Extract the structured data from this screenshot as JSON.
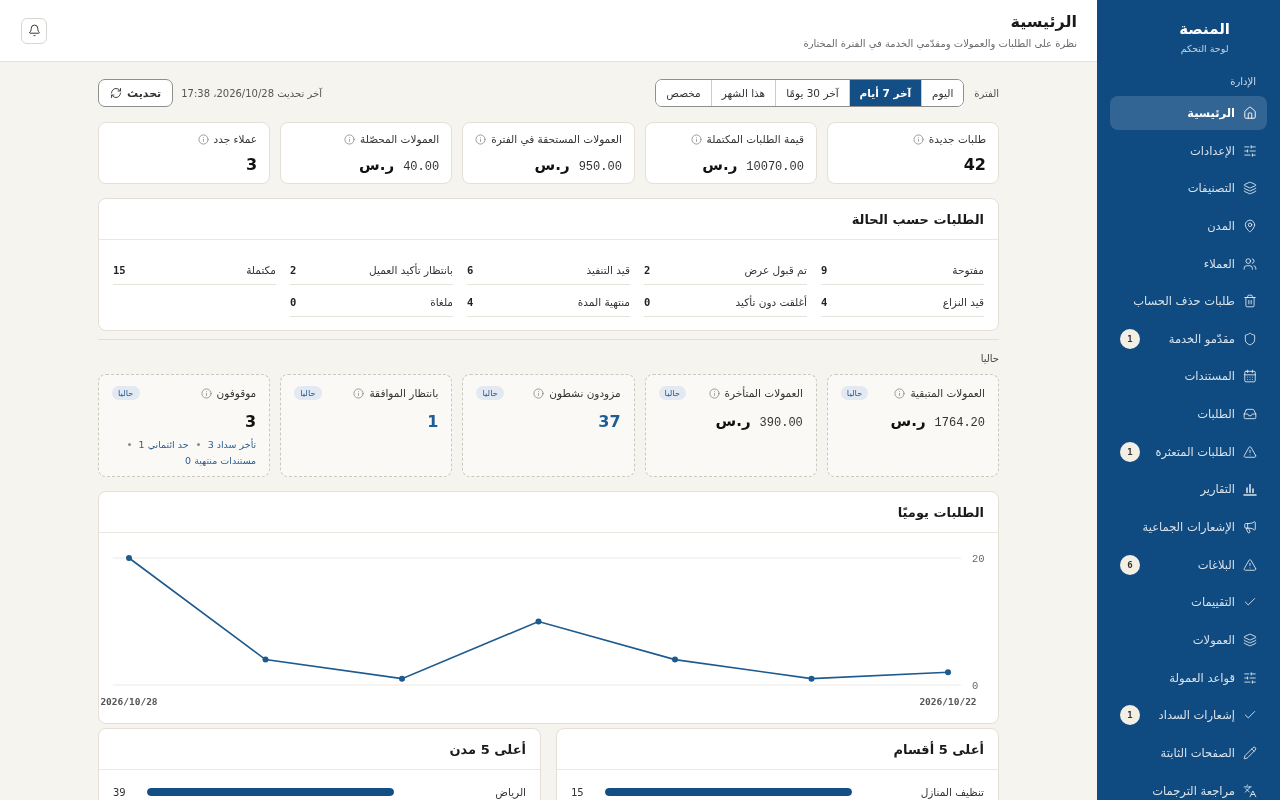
{
  "sidebar": {
    "brand": {
      "title": "المنصة",
      "subtitle": "لوحة التحكم"
    },
    "section_label": "الإدارة",
    "items": [
      {
        "label": "الرئيسية",
        "selected": true
      },
      {
        "label": "الإعدادات",
        "selected": false
      },
      {
        "label": "التصنيفات",
        "selected": false
      },
      {
        "label": "المدن",
        "selected": false
      },
      {
        "label": "العملاء",
        "selected": false
      },
      {
        "label": "طلبات حذف الحساب",
        "selected": false
      },
      {
        "label": "مقدّمو الخدمة",
        "selected": false,
        "badge": "1"
      },
      {
        "label": "المستندات",
        "selected": false
      },
      {
        "label": "الطلبات",
        "selected": false
      },
      {
        "label": "الطلبات المتعثرة",
        "selected": false,
        "badge": "1"
      },
      {
        "label": "التقارير",
        "selected": false
      },
      {
        "label": "الإشعارات الجماعية",
        "selected": false
      },
      {
        "label": "البلاغات",
        "selected": false,
        "badge": "6"
      },
      {
        "label": "التقييمات",
        "selected": false
      },
      {
        "label": "العمولات",
        "selected": false
      },
      {
        "label": "قواعد العمولة",
        "selected": false
      },
      {
        "label": "إشعارات السداد",
        "selected": false,
        "badge": "1"
      },
      {
        "label": "الصفحات الثابتة",
        "selected": false
      },
      {
        "label": "مراجعة الترجمات",
        "selected": false
      }
    ]
  },
  "header": {
    "title": "الرئيسية",
    "subtitle": "نظرة على الطلبات والعمولات ومقدّمي الخدمة في الفترة المختارة"
  },
  "toolbar": {
    "period_label": "الفترة",
    "periods": [
      {
        "label": "اليوم",
        "selected": false
      },
      {
        "label": "آخر 7 أيام",
        "selected": true
      },
      {
        "label": "آخر 30 يومًا",
        "selected": false
      },
      {
        "label": "هذا الشهر",
        "selected": false
      },
      {
        "label": "مخصص",
        "selected": false
      }
    ],
    "last_updated": "آخر تحديث 2026/10/28، 17:38",
    "refresh_label": "تحديث"
  },
  "kpis": [
    {
      "kind": "count",
      "title": "طلبات جديدة",
      "value": "42"
    },
    {
      "kind": "money",
      "title": "قيمة الطلبات المكتملة",
      "value": "10070.00",
      "currency": "ر.س"
    },
    {
      "kind": "money",
      "title": "العمولات المستحقة في الفترة",
      "value": "950.00",
      "currency": "ر.س"
    },
    {
      "kind": "money",
      "title": "العمولات المحصّلة",
      "value": "40.00",
      "currency": "ر.س"
    },
    {
      "kind": "count",
      "title": "عملاء جدد",
      "value": "3"
    }
  ],
  "status_breakdown": {
    "title": "الطلبات حسب الحالة",
    "items": [
      {
        "label": "مفتوحة",
        "count": "9"
      },
      {
        "label": "تم قبول عرض",
        "count": "2"
      },
      {
        "label": "قيد التنفيذ",
        "count": "6"
      },
      {
        "label": "بانتظار تأكيد العميل",
        "count": "2"
      },
      {
        "label": "مكتملة",
        "count": "15"
      },
      {
        "label": "قيد النزاع",
        "count": "4"
      },
      {
        "label": "أغلقت دون تأكيد",
        "count": "0"
      },
      {
        "label": "منتهية المدة",
        "count": "4"
      },
      {
        "label": "ملغاة",
        "count": "0"
      }
    ]
  },
  "current": {
    "label": "حاليا",
    "cards": [
      {
        "kind": "money",
        "title": "العمولات المتبقية",
        "badge": "حاليا",
        "value": "1764.20",
        "currency": "ر.س"
      },
      {
        "kind": "money",
        "title": "العمولات المتأخرة",
        "badge": "حاليا",
        "value": "390.00",
        "currency": "ر.س"
      },
      {
        "kind": "count",
        "title": "مزودون نشطون",
        "badge": "حاليا",
        "value": "37",
        "accent": true
      },
      {
        "kind": "count",
        "title": "بانتظار الموافقة",
        "badge": "حاليا",
        "value": "1",
        "accent": true
      },
      {
        "kind": "count",
        "title": "موقوفون",
        "badge": "حاليا",
        "value": "3",
        "accent": false,
        "details": [
          "تأخر سداد 3",
          "حد ائتماني 1",
          "مستندات منتهية 0"
        ]
      }
    ]
  },
  "daily_orders": {
    "chart_data": {
      "type": "line",
      "title": "الطلبات يوميًا",
      "categories": [
        "2026/10/28",
        null,
        null,
        null,
        null,
        null,
        "2026/10/22"
      ],
      "ylim": [
        0,
        20
      ],
      "yticks": [
        0,
        20
      ],
      "series": [
        {
          "color": "#1d5a8e",
          "marker": "circle",
          "values": [
            20,
            4,
            1,
            10,
            4,
            1,
            2
          ]
        }
      ]
    }
  },
  "top_lists": [
    {
      "title": "أعلى 5 أقسام",
      "rows": [
        {
          "label": "تنظيف المنازل",
          "count": "15",
          "level": 1
        }
      ]
    },
    {
      "title": "أعلى 5 مدن",
      "rows": [
        {
          "label": "الرياض",
          "count": "39",
          "level": 1
        }
      ]
    }
  ]
}
